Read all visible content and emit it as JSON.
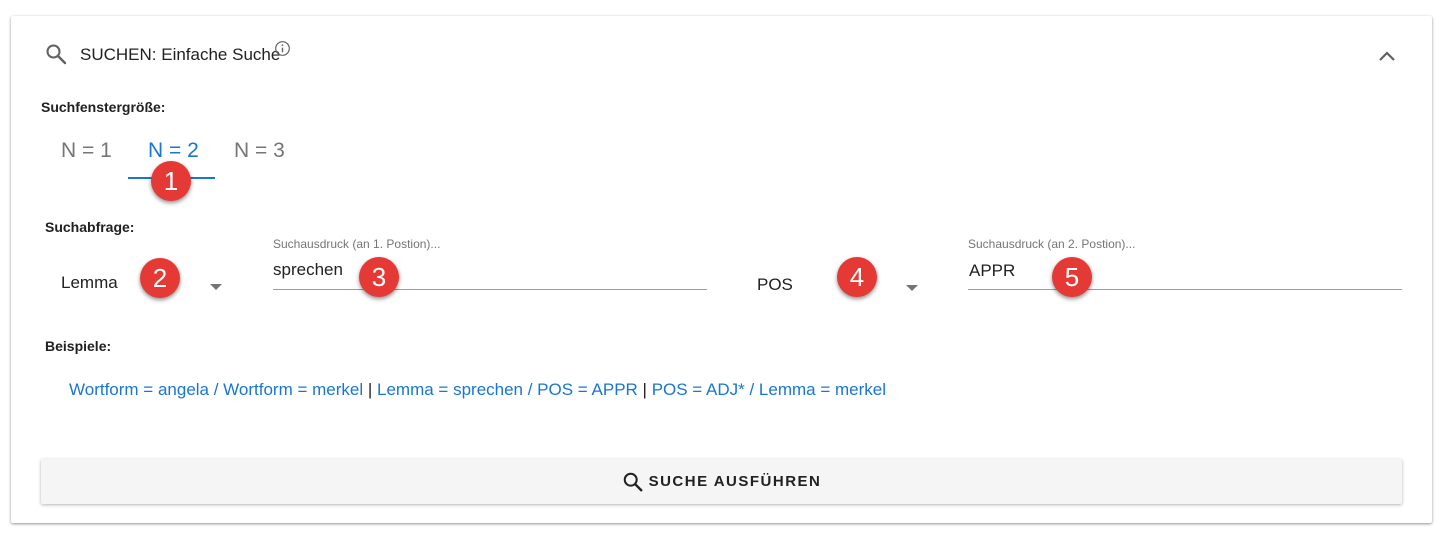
{
  "header": {
    "title": "SUCHEN: Einfache Suche",
    "icon": "search-icon",
    "info_icon": "info-icon",
    "collapse_icon": "chevron-up-icon"
  },
  "window_size": {
    "label": "Suchfenstergröße:",
    "tabs": [
      {
        "label": "N = 1",
        "active": false
      },
      {
        "label": "N = 2",
        "active": true
      },
      {
        "label": "N = 3",
        "active": false
      }
    ]
  },
  "query": {
    "label": "Suchabfrage:",
    "slot1": {
      "type_value": "Lemma",
      "field_label": "Suchausdruck (an 1. Postion)...",
      "field_value": "sprechen"
    },
    "slot2": {
      "type_value": "POS",
      "field_label": "Suchausdruck (an 2. Postion)...",
      "field_value": "APPR"
    }
  },
  "examples": {
    "label": "Beispiele:",
    "items": [
      "Wortform = angela / Wortform = merkel",
      "Lemma = sprechen / POS = APPR",
      "POS = ADJ* / Lemma = merkel"
    ],
    "separator": " | "
  },
  "run_button": {
    "label": "SUCHE AUSFÜHREN",
    "icon": "search-icon"
  },
  "callouts": [
    "1",
    "2",
    "3",
    "4",
    "5"
  ],
  "colors": {
    "accent": "#1976d2",
    "callout": "#e53935",
    "button_bg": "#f5f5f5"
  }
}
